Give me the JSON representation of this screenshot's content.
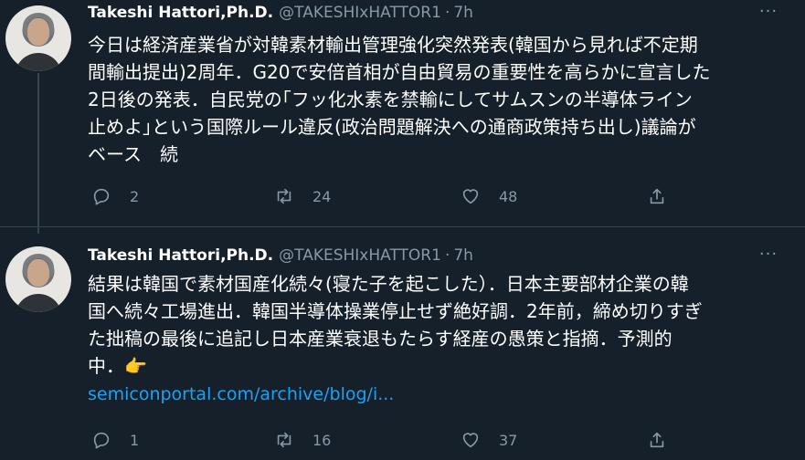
{
  "tweets": [
    {
      "name": "Takeshi Hattori,Ph.D.",
      "handle": "@TAKESHIxHATTOR1",
      "dot": "·",
      "time": "7h",
      "more": "···",
      "text": "今日は経済産業省が対韓素材輸出管理強化突然発表(韓国から見れば不定期\n間輸出提出)2周年．G20で安倍首相が自由貿易の重要性を高らかに宣言した\n2日後の発表．自民党の｢フッ化水素を禁輸にしてサムスンの半導体ライン\n止めよ｣という国際ルール違反(政治問題解決への通商政策持ち出し)議論が\nベース　続",
      "link": "",
      "replies": "2",
      "retweets": "24",
      "likes": "48"
    },
    {
      "name": "Takeshi Hattori,Ph.D.",
      "handle": "@TAKESHIxHATTOR1",
      "dot": "·",
      "time": "7h",
      "more": "···",
      "text": "結果は韓国で素材国産化続々(寝た子を起こした）．日本主要部材企業の韓\n国へ続々工場進出．韓国半導体操業停止せず絶好調．2年前，締め切りすぎ\nた拙稿の最後に追記し日本産業衰退もたらす経産の愚策と指摘．予測的\n中．👉",
      "link": "semiconportal.com/archive/blog/i...",
      "replies": "1",
      "retweets": "16",
      "likes": "37"
    }
  ],
  "icons": {
    "reply": "reply-icon",
    "retweet": "retweet-icon",
    "like": "heart-icon",
    "share": "share-icon",
    "more": "more-icon"
  },
  "colors": {
    "background": "#15202b",
    "divider": "#38444d",
    "secondary_text": "#8899a6",
    "link": "#1da1f2"
  }
}
